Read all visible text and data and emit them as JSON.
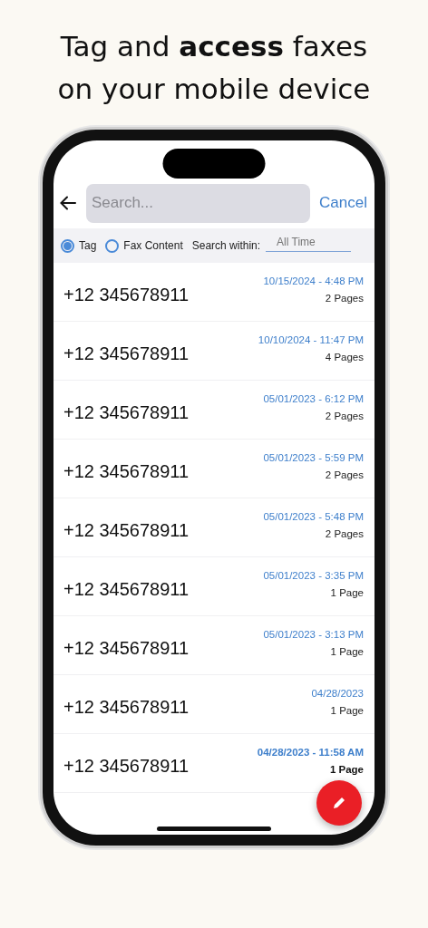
{
  "headline": [
    "Tag and **access** faxes",
    "on your mobile device"
  ],
  "search": {
    "placeholder": "Search...",
    "cancel": "Cancel"
  },
  "filters": {
    "options": [
      {
        "label": "Tag",
        "selected": true
      },
      {
        "label": "Fax Content",
        "selected": false
      }
    ],
    "within_label": "Search within:",
    "time_range": {
      "placeholder": "All Time"
    }
  },
  "faxes": [
    {
      "number": "+12 345678911",
      "date": "10/15/2024 - 4:48 PM",
      "pages": "2 Pages",
      "unread": false
    },
    {
      "number": "+12 345678911",
      "date": "10/10/2024 - 11:47 PM",
      "pages": "4 Pages",
      "unread": false
    },
    {
      "number": "+12 345678911",
      "date": "05/01/2023 - 6:12 PM",
      "pages": "2 Pages",
      "unread": false
    },
    {
      "number": "+12 345678911",
      "date": "05/01/2023 - 5:59 PM",
      "pages": "2 Pages",
      "unread": false
    },
    {
      "number": "+12 345678911",
      "date": "05/01/2023 - 5:48 PM",
      "pages": "2 Pages",
      "unread": false
    },
    {
      "number": "+12 345678911",
      "date": "05/01/2023 - 3:35 PM",
      "pages": "1 Page",
      "unread": false
    },
    {
      "number": "+12 345678911",
      "date": "05/01/2023 - 3:13 PM",
      "pages": "1 Page",
      "unread": false
    },
    {
      "number": "+12 345678911",
      "date": "04/28/2023",
      "pages": "1 Page",
      "unread": false
    },
    {
      "number": "+12 345678911",
      "date": "04/28/2023 - 11:58 AM",
      "pages": "1 Page",
      "unread": true
    }
  ]
}
